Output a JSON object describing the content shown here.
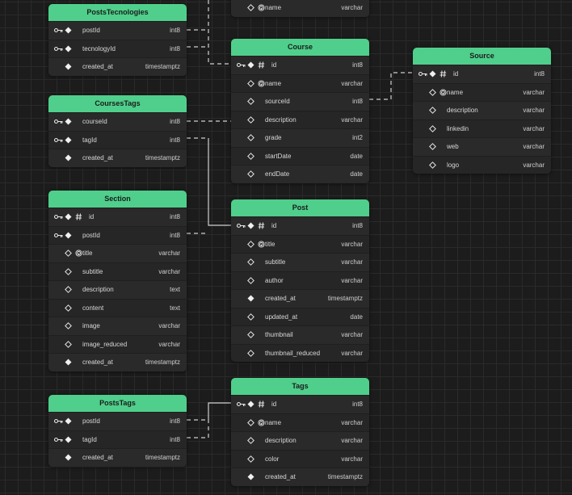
{
  "tables": [
    {
      "key": "partial",
      "title": "",
      "columns": [
        {
          "name": "name",
          "type": "varchar",
          "pk": false,
          "nullable": true,
          "unique": true,
          "idmark": false
        }
      ]
    },
    {
      "key": "poststecnologies",
      "title": "PostsTecnologies",
      "columns": [
        {
          "name": "postId",
          "type": "int8",
          "pk": true,
          "nullable": false,
          "unique": false,
          "idmark": false
        },
        {
          "name": "tecnologyId",
          "type": "int8",
          "pk": true,
          "nullable": false,
          "unique": false,
          "idmark": false
        },
        {
          "name": "created_at",
          "type": "timestamptz",
          "pk": false,
          "nullable": false,
          "unique": false,
          "idmark": false
        }
      ]
    },
    {
      "key": "course",
      "title": "Course",
      "columns": [
        {
          "name": "id",
          "type": "int8",
          "pk": true,
          "nullable": false,
          "unique": false,
          "idmark": true
        },
        {
          "name": "name",
          "type": "varchar",
          "pk": false,
          "nullable": true,
          "unique": true,
          "idmark": false
        },
        {
          "name": "sourceId",
          "type": "int8",
          "pk": false,
          "nullable": true,
          "unique": false,
          "idmark": false
        },
        {
          "name": "description",
          "type": "varchar",
          "pk": false,
          "nullable": true,
          "unique": false,
          "idmark": false
        },
        {
          "name": "grade",
          "type": "int2",
          "pk": false,
          "nullable": true,
          "unique": false,
          "idmark": false
        },
        {
          "name": "startDate",
          "type": "date",
          "pk": false,
          "nullable": true,
          "unique": false,
          "idmark": false
        },
        {
          "name": "endDate",
          "type": "date",
          "pk": false,
          "nullable": true,
          "unique": false,
          "idmark": false
        }
      ]
    },
    {
      "key": "source",
      "title": "Source",
      "columns": [
        {
          "name": "id",
          "type": "int8",
          "pk": true,
          "nullable": false,
          "unique": false,
          "idmark": true
        },
        {
          "name": "name",
          "type": "varchar",
          "pk": false,
          "nullable": true,
          "unique": true,
          "idmark": false
        },
        {
          "name": "description",
          "type": "varchar",
          "pk": false,
          "nullable": true,
          "unique": false,
          "idmark": false
        },
        {
          "name": "linkedin",
          "type": "varchar",
          "pk": false,
          "nullable": true,
          "unique": false,
          "idmark": false
        },
        {
          "name": "web",
          "type": "varchar",
          "pk": false,
          "nullable": true,
          "unique": false,
          "idmark": false
        },
        {
          "name": "logo",
          "type": "varchar",
          "pk": false,
          "nullable": true,
          "unique": false,
          "idmark": false
        }
      ]
    },
    {
      "key": "coursestags",
      "title": "CoursesTags",
      "columns": [
        {
          "name": "courseId",
          "type": "int8",
          "pk": true,
          "nullable": false,
          "unique": false,
          "idmark": false
        },
        {
          "name": "tagId",
          "type": "int8",
          "pk": true,
          "nullable": false,
          "unique": false,
          "idmark": false
        },
        {
          "name": "created_at",
          "type": "timestamptz",
          "pk": false,
          "nullable": false,
          "unique": false,
          "idmark": false
        }
      ]
    },
    {
      "key": "section",
      "title": "Section",
      "columns": [
        {
          "name": "id",
          "type": "int8",
          "pk": true,
          "nullable": false,
          "unique": false,
          "idmark": true
        },
        {
          "name": "postId",
          "type": "int8",
          "pk": true,
          "nullable": false,
          "unique": false,
          "idmark": false
        },
        {
          "name": "title",
          "type": "varchar",
          "pk": false,
          "nullable": true,
          "unique": true,
          "idmark": false
        },
        {
          "name": "subtitle",
          "type": "varchar",
          "pk": false,
          "nullable": true,
          "unique": false,
          "idmark": false
        },
        {
          "name": "description",
          "type": "text",
          "pk": false,
          "nullable": true,
          "unique": false,
          "idmark": false
        },
        {
          "name": "content",
          "type": "text",
          "pk": false,
          "nullable": true,
          "unique": false,
          "idmark": false
        },
        {
          "name": "image",
          "type": "varchar",
          "pk": false,
          "nullable": true,
          "unique": false,
          "idmark": false
        },
        {
          "name": "image_reduced",
          "type": "varchar",
          "pk": false,
          "nullable": true,
          "unique": false,
          "idmark": false
        },
        {
          "name": "created_at",
          "type": "timestamptz",
          "pk": false,
          "nullable": false,
          "unique": false,
          "idmark": false
        }
      ]
    },
    {
      "key": "post",
      "title": "Post",
      "columns": [
        {
          "name": "id",
          "type": "int8",
          "pk": true,
          "nullable": false,
          "unique": false,
          "idmark": true
        },
        {
          "name": "title",
          "type": "varchar",
          "pk": false,
          "nullable": true,
          "unique": true,
          "idmark": false
        },
        {
          "name": "subtitle",
          "type": "varchar",
          "pk": false,
          "nullable": true,
          "unique": false,
          "idmark": false
        },
        {
          "name": "author",
          "type": "varchar",
          "pk": false,
          "nullable": true,
          "unique": false,
          "idmark": false
        },
        {
          "name": "created_at",
          "type": "timestamptz",
          "pk": false,
          "nullable": false,
          "unique": false,
          "idmark": false
        },
        {
          "name": "updated_at",
          "type": "date",
          "pk": false,
          "nullable": true,
          "unique": false,
          "idmark": false
        },
        {
          "name": "thumbnail",
          "type": "varchar",
          "pk": false,
          "nullable": true,
          "unique": false,
          "idmark": false
        },
        {
          "name": "thumbnail_reduced",
          "type": "varchar",
          "pk": false,
          "nullable": true,
          "unique": false,
          "idmark": false
        }
      ]
    },
    {
      "key": "poststags",
      "title": "PostsTags",
      "columns": [
        {
          "name": "postId",
          "type": "int8",
          "pk": true,
          "nullable": false,
          "unique": false,
          "idmark": false
        },
        {
          "name": "tagId",
          "type": "int8",
          "pk": true,
          "nullable": false,
          "unique": false,
          "idmark": false
        },
        {
          "name": "created_at",
          "type": "timestamptz",
          "pk": false,
          "nullable": false,
          "unique": false,
          "idmark": false
        }
      ]
    },
    {
      "key": "tags",
      "title": "Tags",
      "columns": [
        {
          "name": "id",
          "type": "int8",
          "pk": true,
          "nullable": false,
          "unique": false,
          "idmark": true
        },
        {
          "name": "name",
          "type": "varchar",
          "pk": false,
          "nullable": true,
          "unique": true,
          "idmark": false
        },
        {
          "name": "description",
          "type": "varchar",
          "pk": false,
          "nullable": true,
          "unique": false,
          "idmark": false
        },
        {
          "name": "color",
          "type": "varchar",
          "pk": false,
          "nullable": true,
          "unique": false,
          "idmark": false
        },
        {
          "name": "created_at",
          "type": "timestamptz",
          "pk": false,
          "nullable": false,
          "unique": false,
          "idmark": false
        }
      ]
    }
  ],
  "colors": {
    "header": "#4fcf8b",
    "background": "#1c1c1c",
    "connector": "#d0d0d0"
  }
}
